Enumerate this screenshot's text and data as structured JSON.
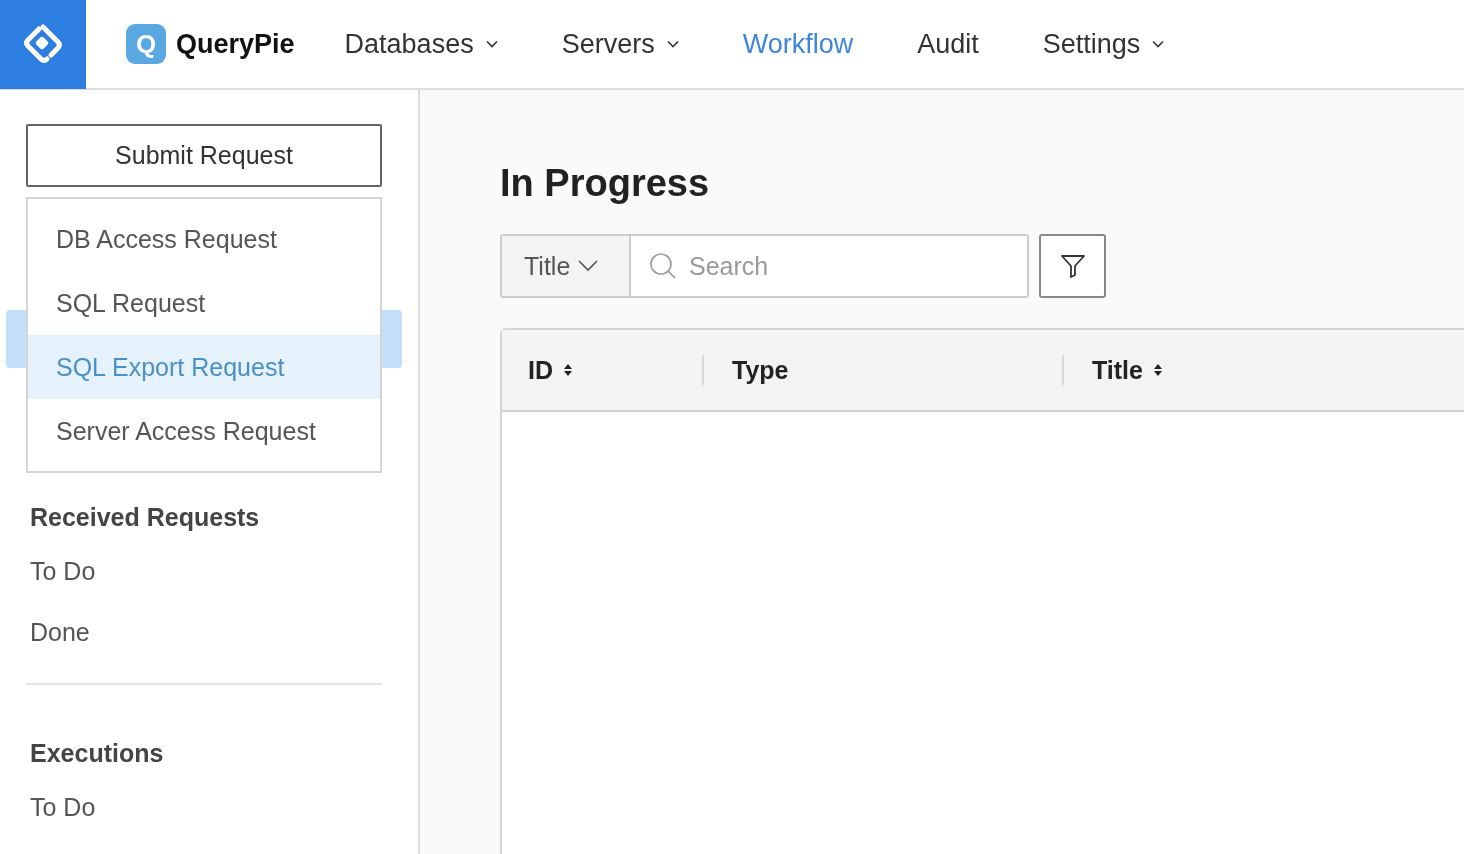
{
  "brand": {
    "name": "QueryPie",
    "badge": "Q"
  },
  "nav": [
    {
      "label": "Databases",
      "dropdown": true,
      "selected": false
    },
    {
      "label": "Servers",
      "dropdown": true,
      "selected": false
    },
    {
      "label": "Workflow",
      "dropdown": false,
      "selected": true
    },
    {
      "label": "Audit",
      "dropdown": false,
      "selected": false
    },
    {
      "label": "Settings",
      "dropdown": true,
      "selected": false
    }
  ],
  "sidebar": {
    "submit_button": "Submit Request",
    "request_menu": [
      {
        "label": "DB Access Request",
        "selected": false
      },
      {
        "label": "SQL Request",
        "selected": false
      },
      {
        "label": "SQL Export Request",
        "selected": true
      },
      {
        "label": "Server Access Request",
        "selected": false
      }
    ],
    "sections": [
      {
        "heading": "Received Requests",
        "items": [
          "To Do",
          "Done"
        ]
      },
      {
        "heading": "Executions",
        "items": [
          "To Do"
        ]
      }
    ]
  },
  "main": {
    "title": "In Progress",
    "search_scope": "Title",
    "search": {
      "placeholder": "Search"
    },
    "table": {
      "columns": [
        {
          "label": "ID",
          "sortable": true
        },
        {
          "label": "Type",
          "sortable": false
        },
        {
          "label": "Title",
          "sortable": true
        }
      ]
    }
  }
}
